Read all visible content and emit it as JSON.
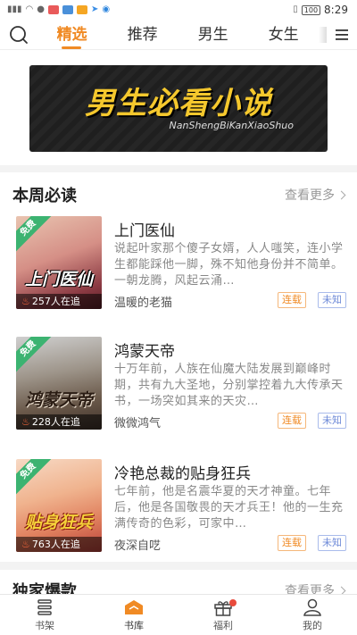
{
  "status_bar": {
    "carrier_text": "",
    "battery": "100",
    "time": "8:29"
  },
  "top_nav": {
    "tabs": [
      {
        "label": "精选",
        "active": true
      },
      {
        "label": "推荐",
        "active": false
      },
      {
        "label": "男生",
        "active": false
      },
      {
        "label": "女生",
        "active": false
      }
    ]
  },
  "banner": {
    "title": "男生必看小说",
    "subtitle": "NanShengBiKanXiaoShuo"
  },
  "weekly_section": {
    "title": "本周必读",
    "more": "查看更多"
  },
  "books": [
    {
      "title": "上门医仙",
      "cover_title": "上门医仙",
      "description": "说起叶家那个傻子女婿，人人嗤笑，连小学生都能踩他一脚，殊不知他身份并不简单。一朝龙腾，风起云涌…",
      "author": "温暖的老猫",
      "readers": "257人在追",
      "status": "连载",
      "words": "未知",
      "free": "免费"
    },
    {
      "title": "鸿蒙天帝",
      "cover_title": "鸿蒙天帝",
      "description": "十万年前，人族在仙魔大陆发展到巅峰时期，共有九大圣地，分别掌控着九大传承天书，一场突如其来的天灾…",
      "author": "微微鸿气",
      "readers": "228人在追",
      "status": "连载",
      "words": "未知",
      "free": "免费"
    },
    {
      "title": "冷艳总裁的贴身狂兵",
      "cover_title": "贴身狂兵",
      "description": "七年前，他是名震华夏的天才神童。七年后，他是各国敬畏的天才兵王！他的一生充满传奇的色彩，可家中…",
      "author": "夜深自呓",
      "readers": "763人在追",
      "status": "连载",
      "words": "未知",
      "free": "免费"
    }
  ],
  "exclusive_section": {
    "title": "独家爆款",
    "more": "查看更多"
  },
  "bottom_nav": [
    {
      "label": "书架",
      "icon": "bookshelf-icon"
    },
    {
      "label": "书库",
      "icon": "library-icon",
      "active": true
    },
    {
      "label": "福利",
      "icon": "gift-icon",
      "badge": true
    },
    {
      "label": "我的",
      "icon": "profile-icon"
    }
  ],
  "colors": {
    "accent": "#f08a24",
    "free_badge": "#3cb371",
    "status_tag": "#f08a24",
    "words_tag": "#6e8ad8"
  }
}
